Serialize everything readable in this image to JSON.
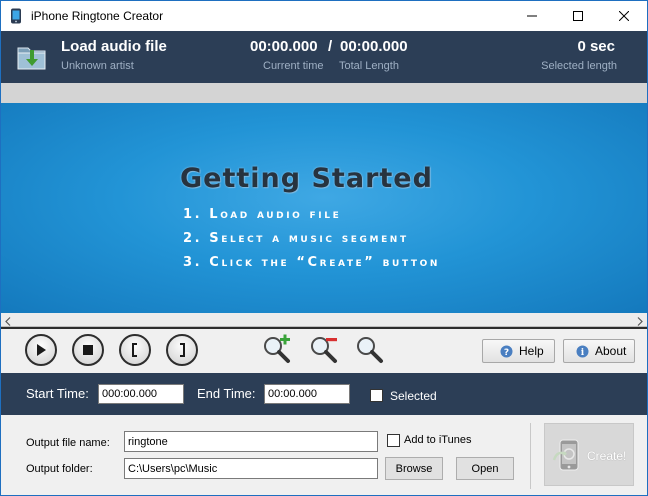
{
  "window": {
    "title": "iPhone Ringtone Creator"
  },
  "header": {
    "load_title": "Load audio file",
    "artist": "Unknown artist",
    "current_time": "00:00.000",
    "separator": "/",
    "total_length": "00:00.000",
    "current_time_label": "Current time",
    "total_length_label": "Total Length",
    "selected_length": "0 sec",
    "selected_length_label": "Selected length"
  },
  "getting_started": {
    "title": "Getting Started",
    "steps": [
      "1. Load audio file",
      "2. Select a music segment",
      "3. Click the “Create” button"
    ]
  },
  "controls": {
    "help_label": "Help",
    "about_label": "About"
  },
  "time_range": {
    "start_label": "Start Time:",
    "start_value": "000:00.000",
    "end_label": "End Time:",
    "end_value": "00:00.000",
    "selected_label": "Selected",
    "selected_checked": false
  },
  "output": {
    "file_name_label": "Output file name:",
    "file_name_value": "ringtone",
    "folder_label": "Output folder:",
    "folder_value": "C:\\Users\\pc\\Music",
    "add_itunes_label": "Add to iTunes",
    "add_itunes_checked": false,
    "browse_label": "Browse",
    "open_label": "Open",
    "create_label": "Create!"
  },
  "colors": {
    "header_bg": "#2c3e56",
    "panel_blue": "#2294d6",
    "window_border": "#1e6fc0"
  }
}
